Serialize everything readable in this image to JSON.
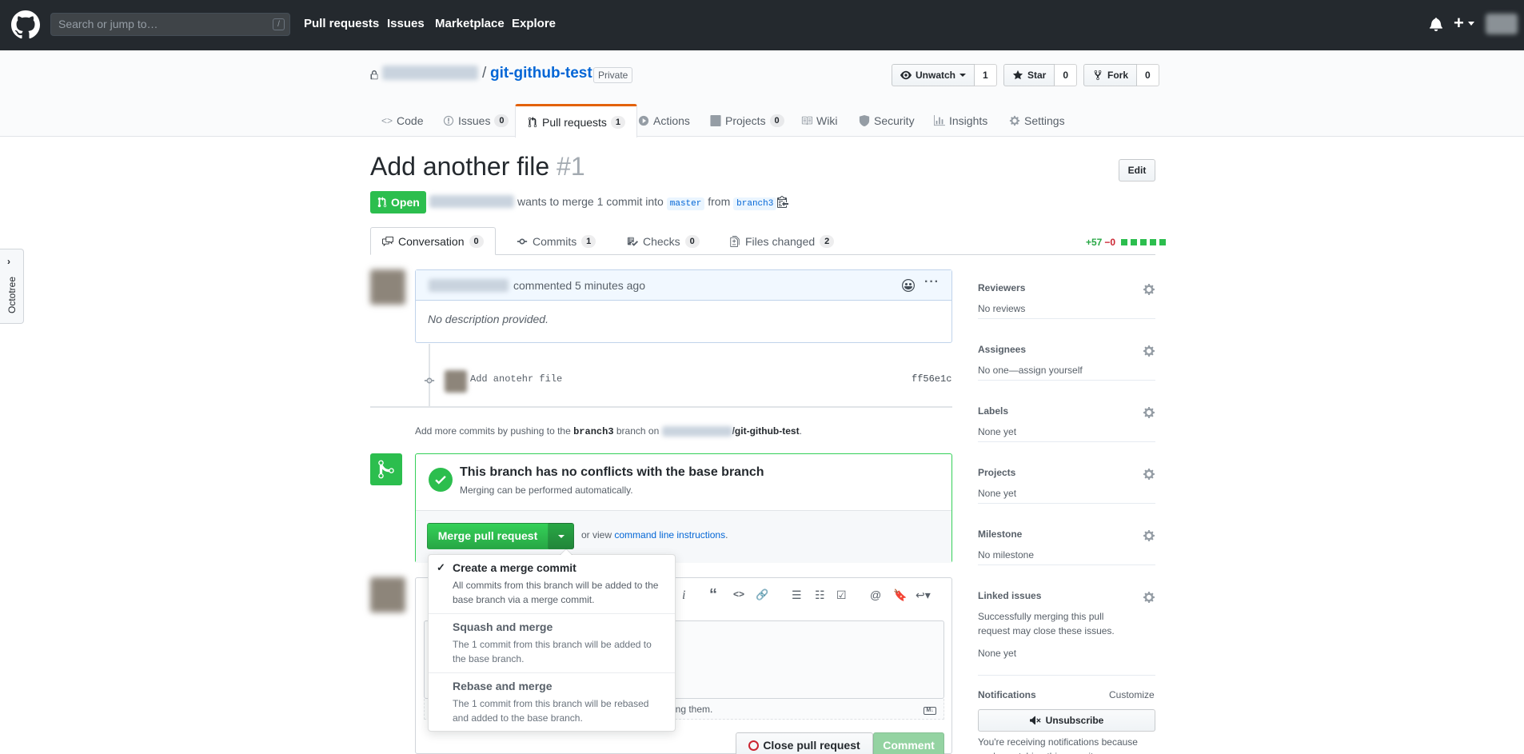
{
  "header": {
    "search_placeholder": "Search or jump to…",
    "search_shortcut": "/",
    "nav": [
      "Pull requests",
      "Issues",
      "Marketplace",
      "Explore"
    ]
  },
  "repo": {
    "slash": "/",
    "name": "git-github-test",
    "visibility": "Private",
    "actions": [
      {
        "label": "Unwatch",
        "count": "1",
        "icon": "eye-icon"
      },
      {
        "label": "Star",
        "count": "0",
        "icon": "star-icon"
      },
      {
        "label": "Fork",
        "count": "0",
        "icon": "fork-icon"
      }
    ],
    "tabs": [
      {
        "label": "Code",
        "icon": "code-icon",
        "count": ""
      },
      {
        "label": "Issues",
        "icon": "issue-icon",
        "count": "0"
      },
      {
        "label": "Pull requests",
        "icon": "pull-request-icon",
        "count": "1"
      },
      {
        "label": "Actions",
        "icon": "play-icon",
        "count": ""
      },
      {
        "label": "Projects",
        "icon": "project-icon",
        "count": "0"
      },
      {
        "label": "Wiki",
        "icon": "book-icon",
        "count": ""
      },
      {
        "label": "Security",
        "icon": "shield-icon",
        "count": ""
      },
      {
        "label": "Insights",
        "icon": "graph-icon",
        "count": ""
      },
      {
        "label": "Settings",
        "icon": "gear-icon",
        "count": ""
      }
    ]
  },
  "pr": {
    "title": "Add another file",
    "number": "#1",
    "edit_label": "Edit",
    "state": "Open",
    "meta_text": "wants to merge 1 commit into",
    "base_branch": "master",
    "from_text": "from",
    "head_branch": "branch3",
    "tabs": [
      {
        "label": "Conversation",
        "count": "0"
      },
      {
        "label": "Commits",
        "count": "1"
      },
      {
        "label": "Checks",
        "count": "0"
      },
      {
        "label": "Files changed",
        "count": "2"
      }
    ],
    "diffstat": {
      "additions": "+57",
      "deletions": "−0"
    }
  },
  "octotree": {
    "label": "Octotree"
  },
  "comment": {
    "action": "commented 5 minutes ago",
    "body": "No description provided."
  },
  "commit": {
    "message": "Add anotehr file",
    "sha": "ff56e1c"
  },
  "push_hint": {
    "prefix": "Add more commits by pushing to the",
    "branch": "branch3",
    "middle": "branch on",
    "repo": "/git-github-test",
    "suffix": "."
  },
  "merge": {
    "heading": "This branch has no conflicts with the base branch",
    "sub": "Merging can be performed automatically.",
    "button": "Merge pull request",
    "or_view": "or view",
    "cli_link": "command line instructions",
    "cli_suffix": ".",
    "options": [
      {
        "title": "Create a merge commit",
        "desc": "All commits from this branch will be added to the base branch via a merge commit.",
        "checked": true
      },
      {
        "title": "Squash and merge",
        "desc": "The 1 commit from this branch will be added to the base branch.",
        "checked": false
      },
      {
        "title": "Rebase and merge",
        "desc": "The 1 commit from this branch will be rebased and added to the base branch.",
        "checked": false
      }
    ]
  },
  "new_comment": {
    "footer_text": "ing them.",
    "markdown_icon": "M↓",
    "close_label": "Close pull request",
    "comment_label": "Comment"
  },
  "sidebar": {
    "sections": [
      {
        "label": "Reviewers",
        "value": "No reviews"
      },
      {
        "label": "Assignees",
        "value": "No one—assign yourself"
      },
      {
        "label": "Labels",
        "value": "None yet"
      },
      {
        "label": "Projects",
        "value": "None yet"
      },
      {
        "label": "Milestone",
        "value": "No milestone"
      },
      {
        "label": "Linked issues",
        "value": "Successfully merging this pull request may close these issues.",
        "value2": "None yet"
      }
    ],
    "notifications": {
      "label": "Notifications",
      "customize": "Customize",
      "button": "Unsubscribe",
      "text": "You're receiving notifications because you're watching this repository."
    }
  },
  "colors": {
    "header_bg": "#24292e",
    "accent_green": "#2cbe4e",
    "link": "#0366d6",
    "tab_accent": "#e36209"
  }
}
